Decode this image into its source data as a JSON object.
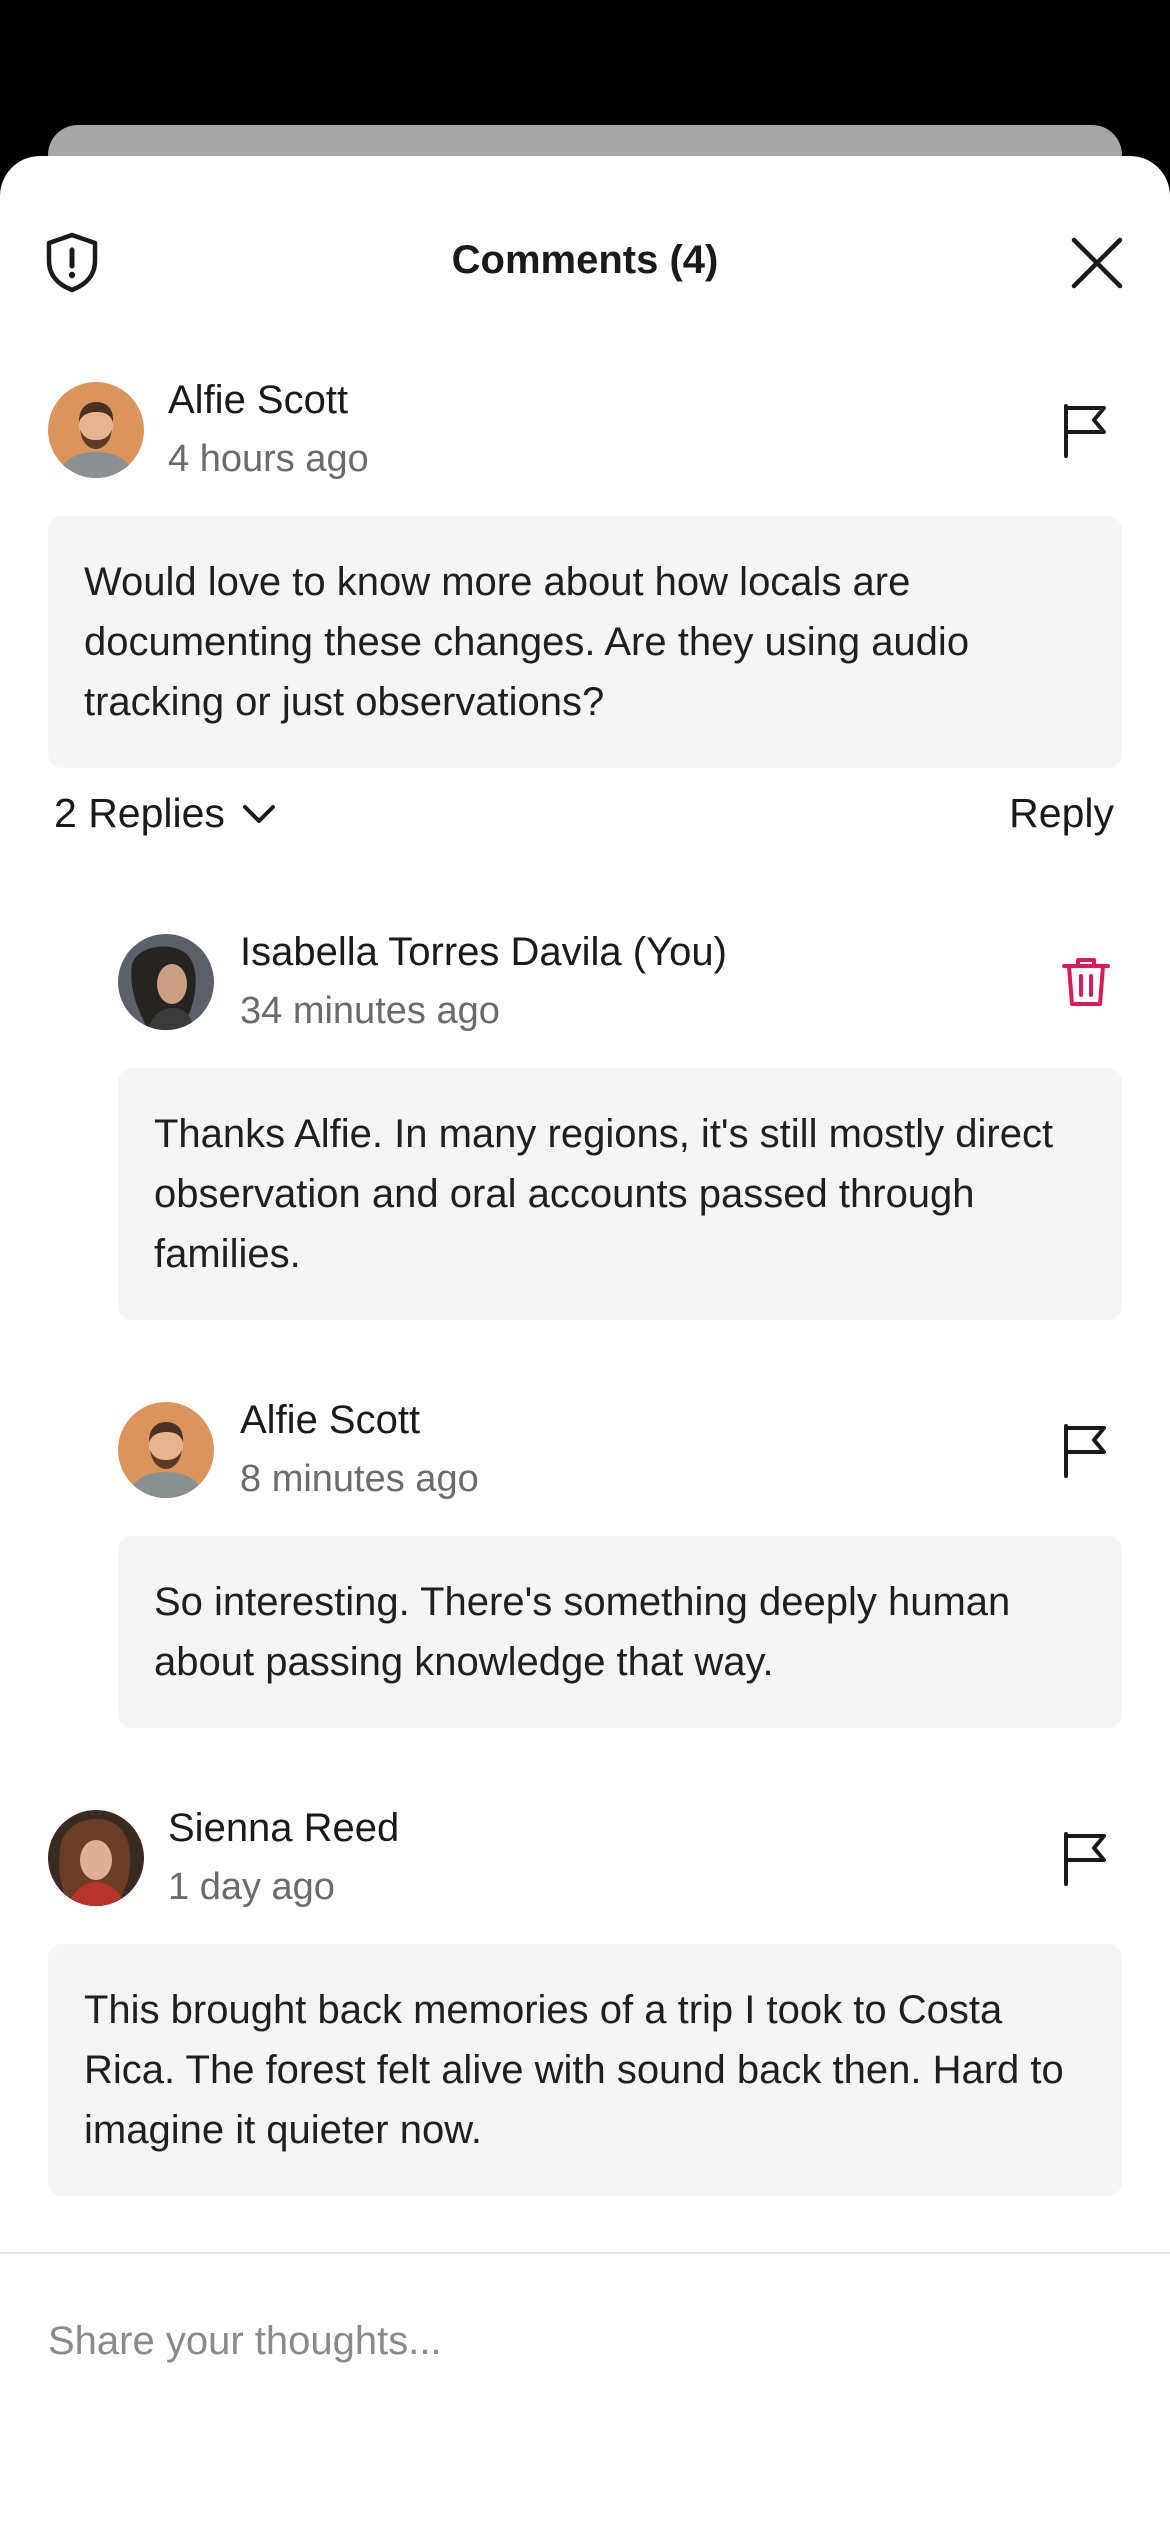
{
  "sheet": {
    "title": "Comments (4)"
  },
  "comments": [
    {
      "author": "Alfie Scott",
      "time": "4 hours ago",
      "text": "Would love to know more about how locals are documenting these changes. Are they using audio tracking or just observations?",
      "action_icon": "flag-icon",
      "replies_label": "2 Replies",
      "reply_label": "Reply",
      "replies": [
        {
          "author": "Isabella Torres Davila (You)",
          "time": "34 minutes ago",
          "text": "Thanks Alfie. In many regions, it's still mostly direct observation and oral accounts passed through families.",
          "action_icon": "trash-icon"
        },
        {
          "author": "Alfie Scott",
          "time": "8 minutes ago",
          "text": "So interesting. There's something deeply human about passing knowledge that way.",
          "action_icon": "flag-icon"
        }
      ]
    },
    {
      "author": "Sienna Reed",
      "time": "1 day ago",
      "text": "This brought back memories of a trip I took to Costa Rica. The forest felt alive with sound back then. Hard to imagine it quieter now.",
      "action_icon": "flag-icon"
    }
  ],
  "composer": {
    "placeholder": "Share your thoughts...",
    "value": ""
  },
  "colors": {
    "delete": "#d81b5a",
    "bubble": "#f5f5f5",
    "muted_text": "#6b6b6b"
  }
}
